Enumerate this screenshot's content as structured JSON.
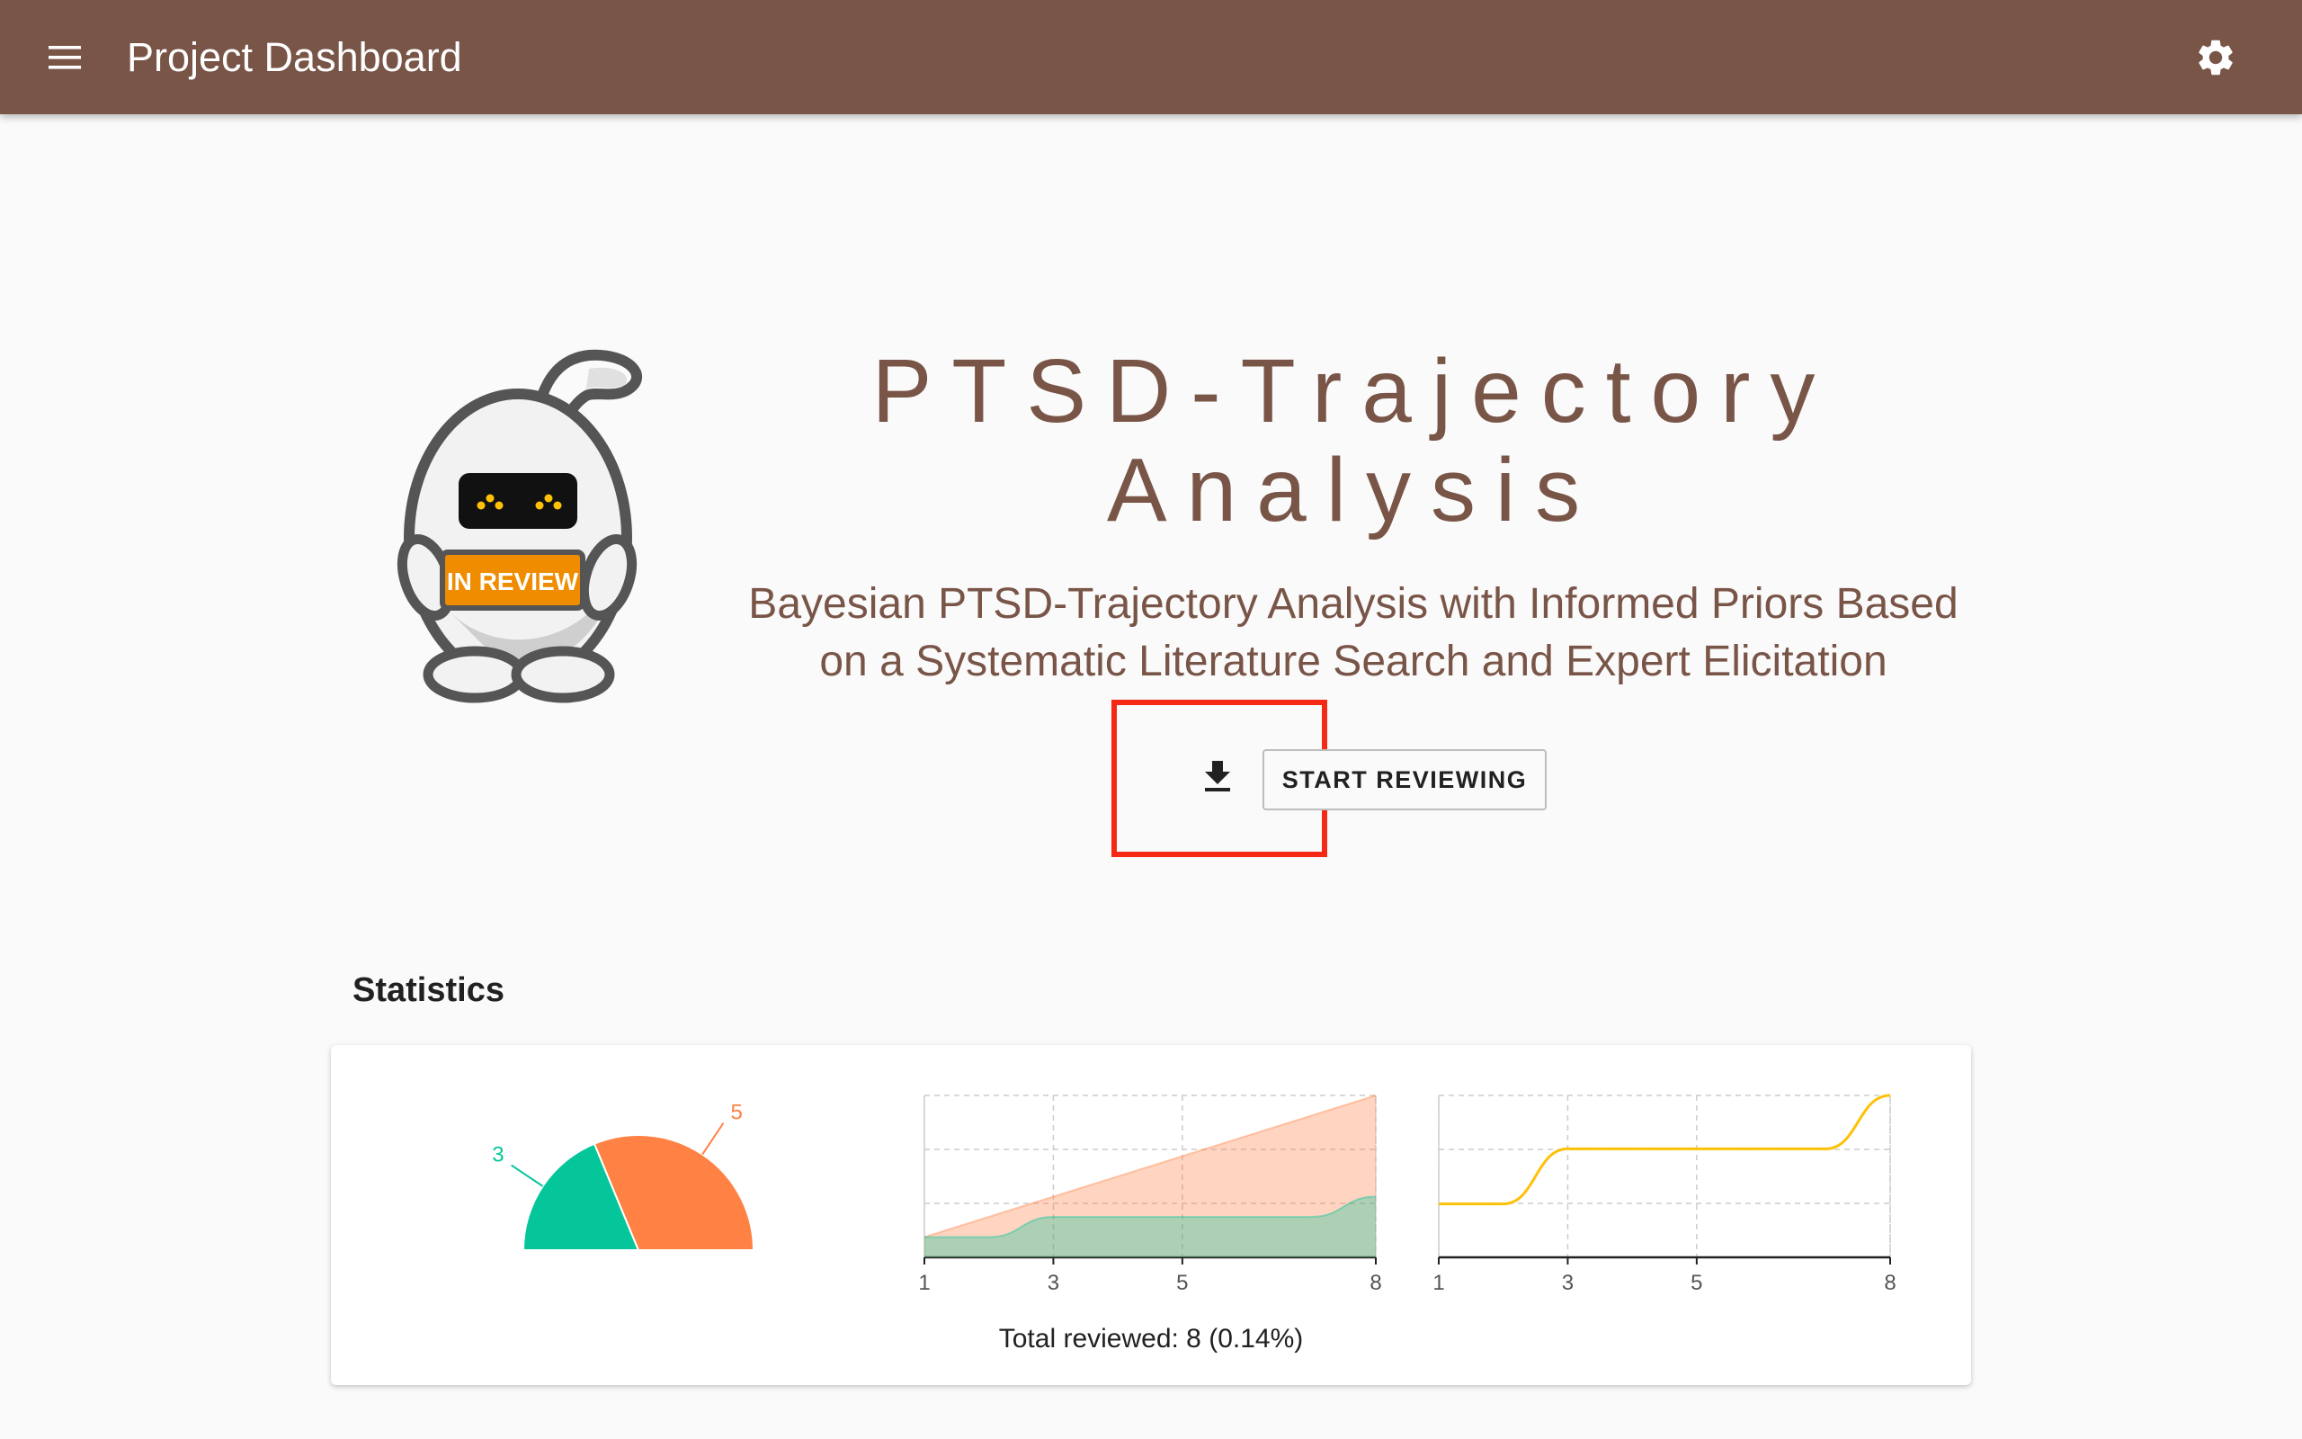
{
  "appbar": {
    "title": "Project Dashboard"
  },
  "project": {
    "title": "PTSD-Trajectory Analysis",
    "subtitle": "Bayesian PTSD-Trajectory Analysis with Informed Priors Based on a Systematic Literature Search and Expert Elicitation",
    "badge": "IN REVIEW"
  },
  "actions": {
    "start_label": "START REVIEWING"
  },
  "statistics": {
    "heading": "Statistics",
    "total_reviewed": "Total reviewed: 8 (0.14%)"
  },
  "colors": {
    "appbar": "#795548",
    "relevant": "#05c69b",
    "irrelevant": "#ff8144",
    "trend": "#ffc107",
    "highlight": "#f42a16"
  },
  "icons": [
    "menu-icon",
    "settings-icon",
    "download-icon"
  ],
  "chart_data": [
    {
      "type": "pie",
      "style": "half-donut",
      "labels": [
        "3",
        "5"
      ],
      "values": [
        3,
        5
      ],
      "colors": [
        "#05c69b",
        "#ff8144"
      ]
    },
    {
      "type": "area",
      "x_ticks": [
        "1",
        "3",
        "5",
        "8"
      ],
      "xlim": [
        1,
        8
      ],
      "ylim": [
        0,
        8
      ],
      "series": [
        {
          "x": [
            1,
            2,
            3,
            4,
            5,
            6,
            7,
            8
          ],
          "values": [
            1,
            1,
            2,
            2,
            2,
            2,
            2,
            3
          ],
          "color": "#05c69b"
        },
        {
          "x": [
            1,
            2,
            3,
            4,
            5,
            6,
            7,
            8
          ],
          "values": [
            1,
            2,
            3,
            4,
            5,
            6,
            7,
            8
          ],
          "color": "#ff8144"
        }
      ]
    },
    {
      "type": "line",
      "x_ticks": [
        "1",
        "3",
        "5",
        "8"
      ],
      "xlim": [
        1,
        8
      ],
      "series": [
        {
          "x": [
            1,
            2,
            3,
            4,
            5,
            6,
            7,
            8
          ],
          "values": [
            0.33,
            0.33,
            0.67,
            0.67,
            0.67,
            0.67,
            0.67,
            1.0
          ],
          "color": "#ffc107"
        }
      ]
    }
  ]
}
